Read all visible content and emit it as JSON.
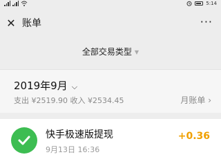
{
  "status_bar": {
    "battery": "",
    "time": "5:14"
  },
  "nav": {
    "title": "账单",
    "close_icon": "close-icon",
    "more_icon": "more-icon",
    "more_text": "···"
  },
  "filter": {
    "label": "全部交易类型"
  },
  "month": {
    "title": "2019年9月",
    "summary": "支出 ¥2519.90 收入 ¥2534.45",
    "bill_button": "月账单 ›"
  },
  "transactions": [
    {
      "title": "快手极速版提现",
      "time": "9月13日 16:36",
      "amount": "+0.36",
      "icon": "wechat-pay-icon"
    }
  ],
  "colors": {
    "income": "#f0a000",
    "wechat_green": "#3dbd52",
    "background": "#ededed"
  }
}
